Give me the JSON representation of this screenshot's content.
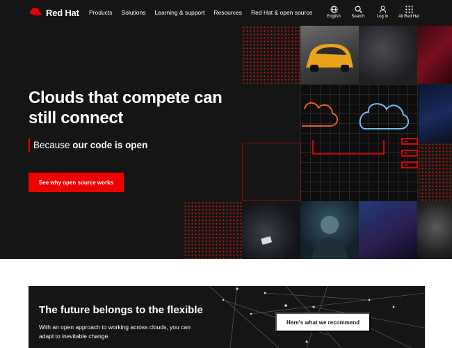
{
  "nav": {
    "brand": "Red Hat",
    "menu": [
      "Products",
      "Solutions",
      "Learning & support",
      "Resources",
      "Red Hat & open source"
    ],
    "utilities": [
      {
        "label": "English",
        "icon": "globe-icon"
      },
      {
        "label": "Search",
        "icon": "search-icon"
      },
      {
        "label": "Log in",
        "icon": "user-icon"
      },
      {
        "label": "All Red Hat",
        "icon": "grid-icon"
      }
    ]
  },
  "hero": {
    "headline": "Clouds that compete can still connect",
    "tagline_prefix": "Because ",
    "tagline_bold": "our code is open",
    "tagline_cursor": "_",
    "cta_label": "See why open source works"
  },
  "promo": {
    "title": "The future belongs to the flexible",
    "text": "With an open approach to working across clouds, you can adapt to inevitable change.",
    "button_label": "Here's what we recommend"
  },
  "colors": {
    "accent": "#ee0000",
    "background_dark": "#151515",
    "cloud_orange": "#e25c2a",
    "cloud_blue": "#73bcf7"
  }
}
